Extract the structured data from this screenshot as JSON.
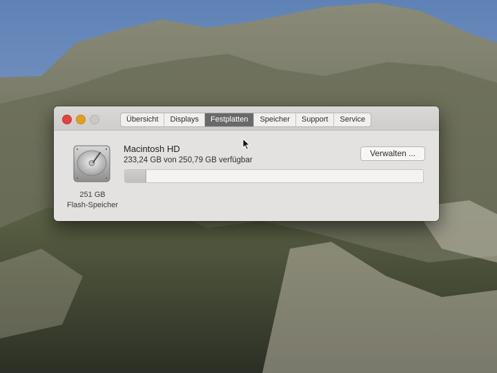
{
  "window": {
    "tabs": [
      {
        "label": "Übersicht",
        "active": false
      },
      {
        "label": "Displays",
        "active": false
      },
      {
        "label": "Festplatten",
        "active": true
      },
      {
        "label": "Speicher",
        "active": false
      },
      {
        "label": "Support",
        "active": false
      },
      {
        "label": "Service",
        "active": false
      }
    ]
  },
  "disk": {
    "icon": "hard-drive-icon",
    "size": "251 GB",
    "type": "Flash-Speicher",
    "volume_name": "Macintosh HD",
    "usage_text": "233,24 GB von 250,79 GB verfügbar",
    "used_fraction": 0.07,
    "manage_label": "Verwalten ..."
  },
  "colors": {
    "close": "#e0443e",
    "minimize": "#dea123",
    "active_tab": "#6a6969"
  }
}
